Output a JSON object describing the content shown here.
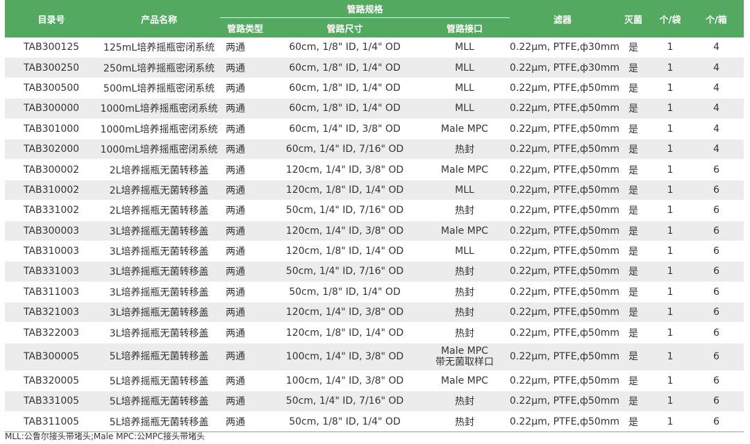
{
  "headers": {
    "catalog_no": "目录号",
    "product_name": "产品名称",
    "tubing_spec": "管路规格",
    "tubing_type": "管路类型",
    "tubing_size": "管路尺寸",
    "tubing_connector": "管路接口",
    "filter": "滤器",
    "sterile": "灭菌",
    "per_bag": "个/袋",
    "per_case": "个/箱"
  },
  "rows": [
    [
      "TAB300125",
      "125mL培养摇瓶密闭系统",
      "两通",
      "60cm, 1/8\" ID, 1/4\" OD",
      "MLL",
      "0.22μm, PTFE,ф30mm",
      "是",
      "1",
      "4"
    ],
    [
      "TAB300250",
      "250mL培养摇瓶密闭系统",
      "两通",
      "60cm, 1/8\" ID, 1/4\" OD",
      "MLL",
      "0.22μm, PTFE,ф30mm",
      "是",
      "1",
      "4"
    ],
    [
      "TAB300500",
      "500mL培养摇瓶密闭系统",
      "两通",
      "60cm, 1/8\" ID, 1/4\" OD",
      "MLL",
      "0.22μm, PTFE,ф50mm",
      "是",
      "1",
      "4"
    ],
    [
      "TAB300000",
      "1000mL培养摇瓶密闭系统",
      "两通",
      "60cm, 1/8\" ID, 1/4\" OD",
      "MLL",
      "0.22μm, PTFE,ф50mm",
      "是",
      "1",
      "4"
    ],
    [
      "TAB301000",
      "1000mL培养摇瓶密闭系统",
      "两通",
      "60cm, 1/4\" ID, 3/8\" OD",
      "Male MPC",
      "0.22μm, PTFE,ф50mm",
      "是",
      "1",
      "4"
    ],
    [
      "TAB302000",
      "1000mL培养摇瓶密闭系统",
      "两通",
      "60cm, 1/4\" ID, 7/16\" OD",
      "热封",
      "0.22μm, PTFE,ф50mm",
      "是",
      "1",
      "4"
    ],
    [
      "TAB300002",
      "2L培养摇瓶无菌转移盖",
      "两通",
      "120cm, 1/4\" ID, 3/8\" OD",
      "Male MPC",
      "0.22μm, PTFE,ф50mm",
      "是",
      "1",
      "6"
    ],
    [
      "TAB310002",
      "2L培养摇瓶无菌转移盖",
      "两通",
      "120cm, 1/8\" ID, 1/4\" OD",
      "MLL",
      "0.22μm, PTFE,ф50mm",
      "是",
      "1",
      "6"
    ],
    [
      "TAB331002",
      "2L培养摇瓶无菌转移盖",
      "两通",
      "50cm, 1/4\" ID, 7/16\" OD",
      "热封",
      "0.22μm, PTFE,ф50mm",
      "是",
      "1",
      "6"
    ],
    [
      "TAB300003",
      "3L培养摇瓶无菌转移盖",
      "两通",
      "120cm, 1/4\" ID, 3/8\" OD",
      "Male MPC",
      "0.22μm, PTFE,ф50mm",
      "是",
      "1",
      "6"
    ],
    [
      "TAB310003",
      "3L培养摇瓶无菌转移盖",
      "两通",
      "120cm, 1/8\" ID, 1/4\" OD",
      "MLL",
      "0.22μm, PTFE,ф50mm",
      "是",
      "1",
      "6"
    ],
    [
      "TAB331003",
      "3L培养摇瓶无菌转移盖",
      "两通",
      "50cm, 1/4\" ID, 7/16\" OD",
      "热封",
      "0.22μm, PTFE,ф50mm",
      "是",
      "1",
      "6"
    ],
    [
      "TAB311003",
      "3L培养摇瓶无菌转移盖",
      "两通",
      "50cm, 1/8\" ID, 1/4\" OD",
      "热封",
      "0.22μm, PTFE,ф50mm",
      "是",
      "1",
      "6"
    ],
    [
      "TAB321003",
      "3L培养摇瓶无菌转移盖",
      "两通",
      "120cm, 1/4\" ID, 3/8\" OD",
      "热封",
      "0.22μm, PTFE,ф50mm",
      "是",
      "1",
      "6"
    ],
    [
      "TAB322003",
      "3L培养摇瓶无菌转移盖",
      "两通",
      "120cm, 1/8\" ID, 1/4\" OD",
      "热封",
      "0.22μm, PTFE,ф50mm",
      "是",
      "1",
      "6"
    ],
    [
      "TAB300005",
      "5L培养摇瓶无菌转移盖",
      "两通",
      "100cm, 1/4\" ID, 3/8\" OD",
      "Male MPC\n带无菌取样口",
      "0.22μm, PTFE,ф50mm",
      "是",
      "1",
      "6"
    ],
    [
      "TAB320005",
      "5L培养摇瓶无菌转移盖",
      "两通",
      "100cm, 1/4\" ID, 3/8\" OD",
      "Male MPC",
      "0.22μm, PTFE,ф50mm",
      "是",
      "1",
      "6"
    ],
    [
      "TAB331005",
      "5L培养摇瓶无菌转移盖",
      "两通",
      "50cm, 1/4\" ID, 7/16\" OD",
      "热封",
      "0.22μm, PTFE,ф50mm",
      "是",
      "1",
      "6"
    ],
    [
      "TAB311005",
      "5L培养摇瓶无菌转移盖",
      "两通",
      "50cm, 1/8\" ID, 1/4\" OD",
      "热封",
      "0.22μm, PTFE,ф50mm",
      "是",
      "1",
      "6"
    ]
  ],
  "footnote": "MLL:公鲁尔接头带堵头;Male MPC:公MPC接头带堵头",
  "colors": {
    "header_bg": "#52a95f",
    "header_text": "#ffffff",
    "row_alt_bg": "#ececec"
  }
}
